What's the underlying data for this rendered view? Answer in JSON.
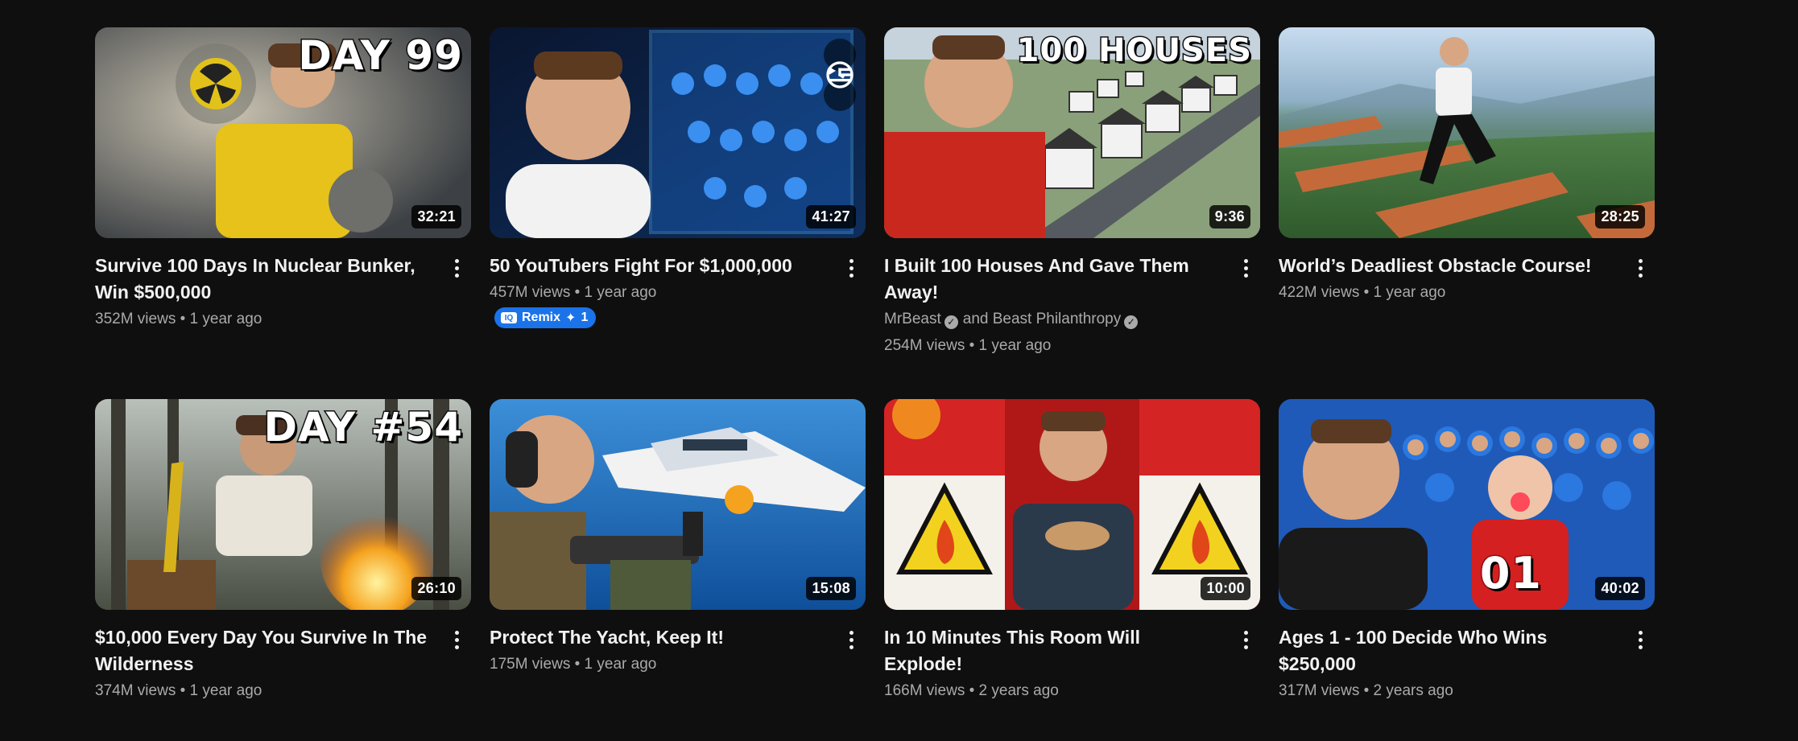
{
  "videos": [
    {
      "title": "Survive 100 Days In Nuclear Bunker, Win $500,000",
      "views": "352M views",
      "age": "1 year ago",
      "duration": "32:21",
      "thumb_text": "DAY 99",
      "thumb_colors": [
        "#6b6f73",
        "#e6c21a"
      ]
    },
    {
      "title": "50 YouTubers Fight For $1,000,000",
      "views": "457M views",
      "age": "1 year ago",
      "duration": "41:27",
      "remix_label": "Remix",
      "remix_count": "1",
      "thumb_colors": [
        "#0a1a3a",
        "#2a8ef0"
      ]
    },
    {
      "title": "I Built 100 Houses And Gave Them Away!",
      "channel_1": "MrBeast",
      "channel_joiner": "and",
      "channel_2": "Beast Philanthropy",
      "views": "254M views",
      "age": "1 year ago",
      "duration": "9:36",
      "thumb_text": "100 HOUSES",
      "thumb_colors": [
        "#8a9bb0",
        "#cf2a1e"
      ]
    },
    {
      "title": "World’s Deadliest Obstacle Course!",
      "views": "422M views",
      "age": "1 year ago",
      "duration": "28:25",
      "thumb_colors": [
        "#a8c8e8",
        "#3f7a3a"
      ]
    },
    {
      "title": "$10,000 Every Day You Survive In The Wilderness",
      "views": "374M views",
      "age": "1 year ago",
      "duration": "26:10",
      "thumb_text": "DAY #54",
      "thumb_colors": [
        "#7d8a7f",
        "#f29a1e"
      ]
    },
    {
      "title": "Protect The Yacht, Keep It!",
      "views": "175M views",
      "age": "1 year ago",
      "duration": "15:08",
      "thumb_colors": [
        "#1f6fb8",
        "#6b5a3a"
      ]
    },
    {
      "title": "In 10 Minutes This Room Will Explode!",
      "views": "166M views",
      "age": "2 years ago",
      "duration": "10:00",
      "thumb_colors": [
        "#c81e1e",
        "#f2d21e"
      ]
    },
    {
      "title": "Ages 1 - 100 Decide Who Wins $250,000",
      "views": "317M views",
      "age": "2 years ago",
      "duration": "40:02",
      "thumb_text_small": "01",
      "thumb_colors": [
        "#2a6fd0",
        "#d42020"
      ]
    }
  ],
  "separator": "•",
  "accent": "#1a73e8"
}
